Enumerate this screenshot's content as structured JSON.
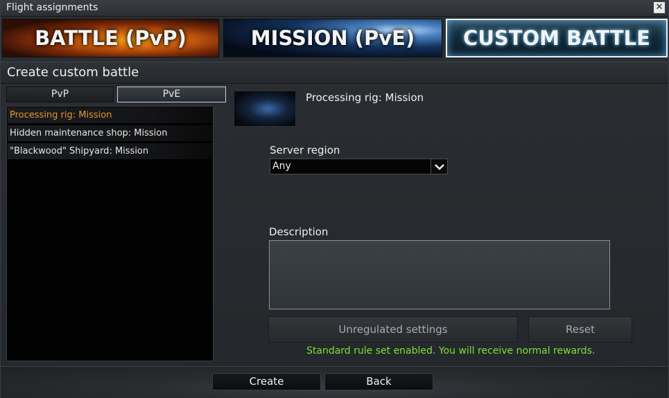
{
  "window": {
    "title": "Flight assignments",
    "close_glyph": "✕"
  },
  "mode_tabs": [
    {
      "label": "BATTLE (PvP)"
    },
    {
      "label": "MISSION (PvE)"
    },
    {
      "label": "CUSTOM BATTLE",
      "selected": true
    }
  ],
  "section": {
    "title": "Create custom battle"
  },
  "sub_tabs": [
    {
      "label": "PvP"
    },
    {
      "label": "PvE",
      "selected": true
    }
  ],
  "missions": [
    {
      "label": "Processing rig: Mission",
      "selected": true
    },
    {
      "label": "Hidden maintenance shop: Mission"
    },
    {
      "label": "\"Blackwood\" Shipyard: Mission"
    }
  ],
  "details": {
    "mission_title": "Processing rig: Mission",
    "server_region_label": "Server region",
    "server_region_value": "Any",
    "description_label": "Description",
    "unregulated_settings_button": "Unregulated settings",
    "reset_button": "Reset",
    "status_text": "Standard rule set enabled. You will receive normal rewards."
  },
  "footer": {
    "create_button": "Create",
    "back_button": "Back"
  },
  "colors": {
    "selected_item": "#e8962a",
    "status_green": "#7de036"
  }
}
